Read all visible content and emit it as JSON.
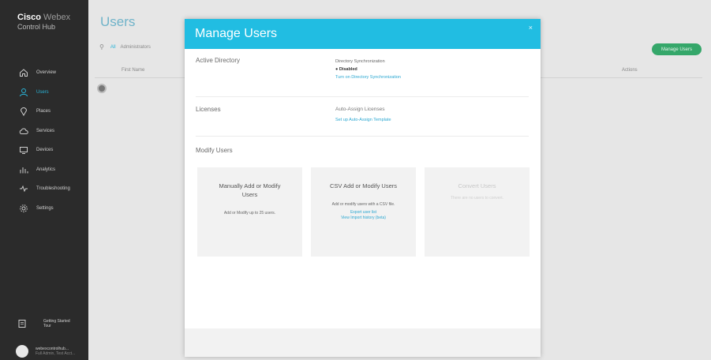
{
  "brand": {
    "name_bold": "Cisco",
    "name_light": "Webex",
    "subtitle": "Control Hub"
  },
  "sidebar": {
    "items": [
      {
        "label": "Overview",
        "icon": "home-icon"
      },
      {
        "label": "Users",
        "icon": "user-icon",
        "active": true
      },
      {
        "label": "Places",
        "icon": "location-icon"
      },
      {
        "label": "Services",
        "icon": "cloud-icon"
      },
      {
        "label": "Devices",
        "icon": "monitor-icon"
      },
      {
        "label": "Analytics",
        "icon": "chart-icon"
      },
      {
        "label": "Troubleshooting",
        "icon": "pulse-icon"
      },
      {
        "label": "Settings",
        "icon": "gear-icon"
      }
    ],
    "bottom_item": "Getting Started Tour",
    "account_line1": "webexcontrolhub...",
    "account_line2": "Full Admin, Test Acct..."
  },
  "page": {
    "title": "Users",
    "filter_all": "All",
    "filter_next": "Administrators",
    "manage_users_button": "Manage Users",
    "col_first_name": "First Name",
    "col_actions": "Actions"
  },
  "modal": {
    "title": "Manage Users",
    "close": "×",
    "active_directory": {
      "label": "Active Directory",
      "heading": "Directory Synchronization",
      "status": "Disabled",
      "link": "Turn on Directory Synchronization"
    },
    "licenses": {
      "label": "Licenses",
      "heading": "Auto-Assign Licenses",
      "link": "Set up Auto-Assign Template"
    },
    "modify_users_label": "Modify Users",
    "cards": {
      "manual": {
        "title": "Manually Add or Modify Users",
        "desc": "Add or Modify up to 25 users."
      },
      "csv": {
        "title": "CSV Add or Modify Users",
        "desc": "Add or modify users with a CSV file.",
        "link1": "Export user list",
        "link2": "View Import history (beta)"
      },
      "convert": {
        "title": "Convert Users",
        "desc": "There are no users to convert."
      }
    }
  },
  "colors": {
    "accent": "#21bde2",
    "sidebar": "#2b2b2b",
    "button_green": "#35a76a"
  }
}
